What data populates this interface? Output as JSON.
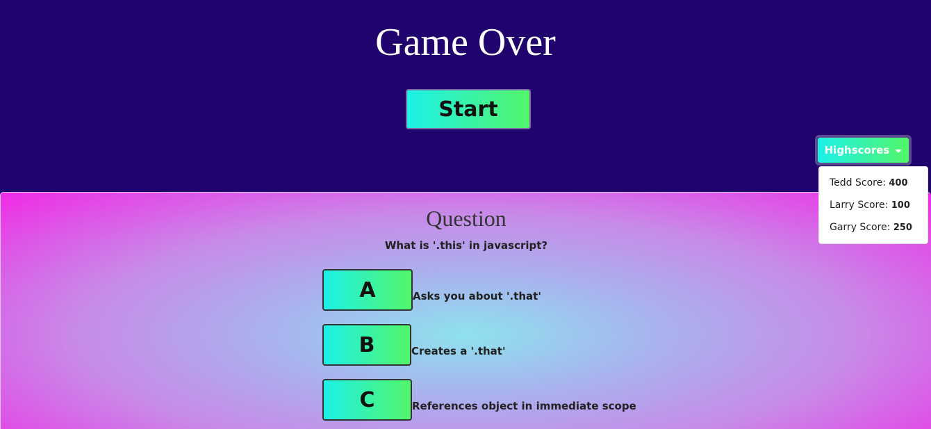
{
  "header": {
    "title": "Game Over",
    "start_label": "Start",
    "highscores_label": "Highscores"
  },
  "highscores": [
    {
      "label": "Tedd Score: ",
      "score": "400"
    },
    {
      "label": "Larry Score: ",
      "score": "100"
    },
    {
      "label": "Garry Score: ",
      "score": "250"
    }
  ],
  "question": {
    "heading": "Question",
    "text": "What is '.this' in javascript?",
    "answers": [
      {
        "letter": "A",
        "text": "Asks you about '.that'"
      },
      {
        "letter": "B",
        "text": "Creates a '.that'"
      },
      {
        "letter": "C",
        "text": "References object in immediate scope"
      }
    ]
  },
  "colors": {
    "header_bg": "#21036e",
    "button_gradient_start": "#1df0e8",
    "button_gradient_end": "#52f66a",
    "quiz_center": "#8ee2ee",
    "quiz_edge": "#f02ae6"
  }
}
